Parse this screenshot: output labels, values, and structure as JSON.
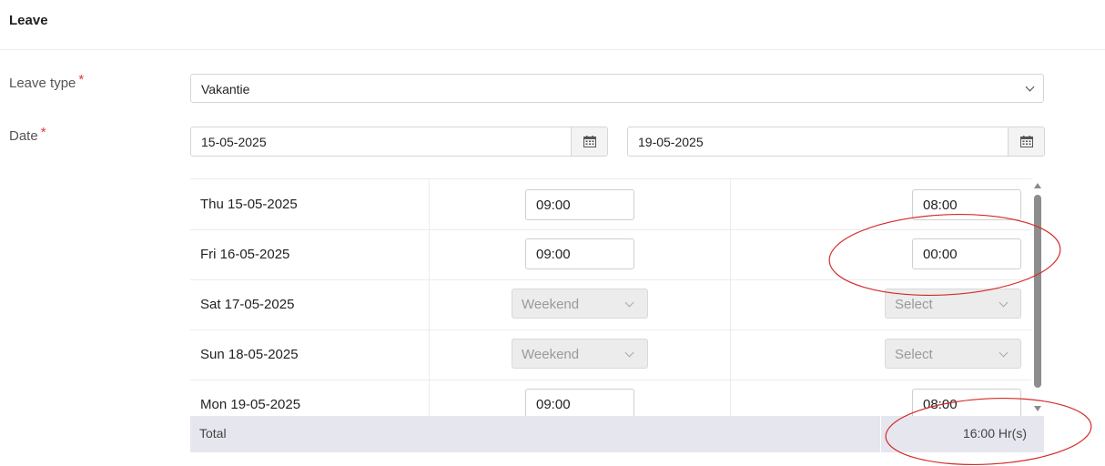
{
  "header": {
    "title": "Leave"
  },
  "form": {
    "leave_type": {
      "label": "Leave type",
      "required_mark": "*",
      "value": "Vakantie"
    },
    "date": {
      "label": "Date",
      "required_mark": "*",
      "from": "15-05-2025",
      "to": "19-05-2025"
    }
  },
  "days": [
    {
      "date": "Thu 15-05-2025",
      "start": "09:00",
      "hours": "08:00"
    },
    {
      "date": "Fri 16-05-2025",
      "start": "09:00",
      "hours": "00:00"
    },
    {
      "date": "Sat 17-05-2025",
      "start": "Weekend",
      "hours": "Select"
    },
    {
      "date": "Sun 18-05-2025",
      "start": "Weekend",
      "hours": "Select"
    },
    {
      "date": "Mon 19-05-2025",
      "start": "09:00",
      "hours": "08:00"
    }
  ],
  "total": {
    "label": "Total",
    "value": "16:00 Hr(s)"
  },
  "icons": {
    "calendar": "calendar-icon",
    "dropdown": "chevron-down-icon"
  },
  "colors": {
    "required": "#e0393e",
    "annotation": "#d42a2a",
    "total_bg": "#e6e6ef"
  }
}
